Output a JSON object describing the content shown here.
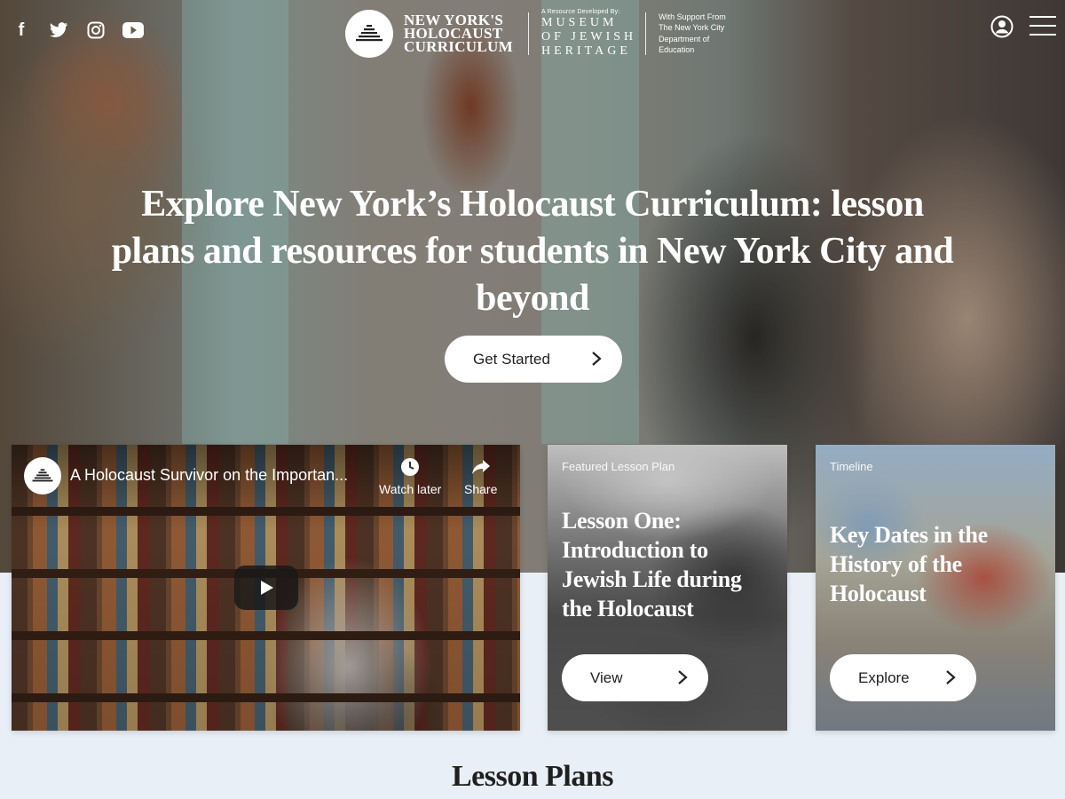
{
  "social": {
    "facebook": "f",
    "twitter": "twitter-icon",
    "instagram": "instagram-icon",
    "youtube": "youtube-icon"
  },
  "header": {
    "logo_title": "NEW YORK'S HOLOCAUST CURRICULUM",
    "developed_by": "A Resource Developed By:",
    "museum_lines": [
      "MUSEUM",
      "OF JEWISH",
      "HERITAGE"
    ],
    "support_text": "With Support From The New York City Department of Education"
  },
  "hero": {
    "headline": "Explore New York’s Holocaust Curriculum: lesson plans and resources for students in New York City and beyond",
    "cta_label": "Get Started"
  },
  "video": {
    "title": "A Holocaust Survivor on the Importan...",
    "watch_later": "Watch later",
    "share": "Share"
  },
  "lesson_card": {
    "kicker": "Featured Lesson Plan",
    "title": "Lesson One: Introduction to Jewish Life during the Holocaust",
    "button": "View"
  },
  "timeline_card": {
    "kicker": "Timeline",
    "title": "Key Dates in the History of the Holocaust",
    "button": "Explore"
  },
  "section": {
    "title": "Lesson Plans"
  },
  "colors": {
    "page_bg": "#e9eff6",
    "button_bg": "#ffffff",
    "text_dark": "#1f1f1f"
  }
}
